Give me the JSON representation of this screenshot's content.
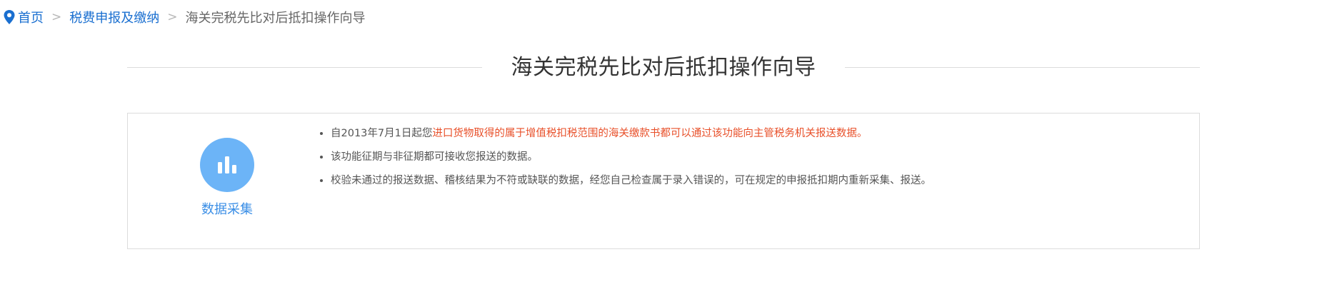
{
  "breadcrumb": {
    "home": "首页",
    "level1": "税费申报及缴纳",
    "current": "海关完税先比对后抵扣操作向导",
    "separator": ">"
  },
  "page_title": "海关完税先比对后抵扣操作向导",
  "feature": {
    "label": "数据采集",
    "icon": "bar-chart-icon",
    "icon_bg_color": "#6cb4f7"
  },
  "notes": {
    "item1_prefix": "自2013年7月1日起您",
    "item1_highlight": "进口货物取得的属于增值税扣税范围的海关缴款书都可以通过该功能向主管税务机关报送数据。",
    "item2": "该功能征期与非征期都可接收您报送的数据。",
    "item3": "校验未通过的报送数据、稽核结果为不符或缺联的数据，经您自己检查属于录入错误的，可在规定的申报抵扣期内重新采集、报送。"
  },
  "colors": {
    "link": "#1a6fd0",
    "highlight": "#e8502a",
    "accent": "#3a8ee6"
  }
}
